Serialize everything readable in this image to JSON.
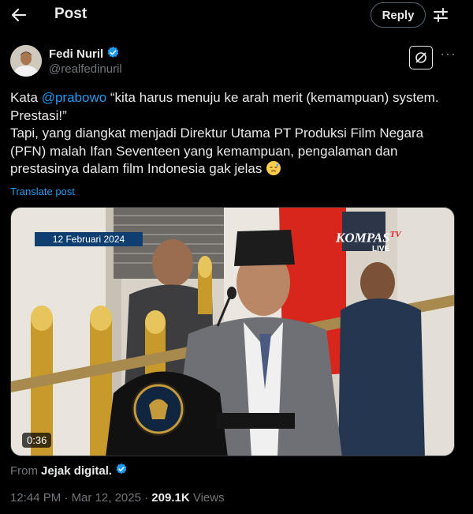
{
  "header": {
    "title": "Post",
    "reply_label": "Reply"
  },
  "author": {
    "name": "Fedi Nuril",
    "handle": "@realfedinuril"
  },
  "post": {
    "line1_prefix": "Kata ",
    "mention": "@prabowo",
    "line1_rest": " “kita harus menuju ke arah merit (kemampuan) system. Prestasi!”",
    "line2": "Tapi, yang diangkat menjadi Direktur Utama PT Produksi Film Negara (PFN) malah Ifan Seventeen yang kemampuan, pengalaman dan prestasinya dalam film Indonesia gak jelas",
    "emoji": "sad-relieved-face-emoji",
    "translate_label": "Translate post"
  },
  "media": {
    "date_banner": "12 Februari 2024",
    "channel_logo": "KOMPAS",
    "channel_suffix": "TV",
    "live_label": "LIVE",
    "duration": "0:36"
  },
  "source": {
    "prefix": "From",
    "name": "Jejak digital."
  },
  "meta": {
    "time": "12:44 PM",
    "date": "Mar 12, 2025",
    "views_count": "209.1K",
    "views_label": "Views"
  },
  "colors": {
    "background": "#000000",
    "text": "#e7e9ea",
    "secondary": "#71767b",
    "accent": "#1d9bf0"
  }
}
